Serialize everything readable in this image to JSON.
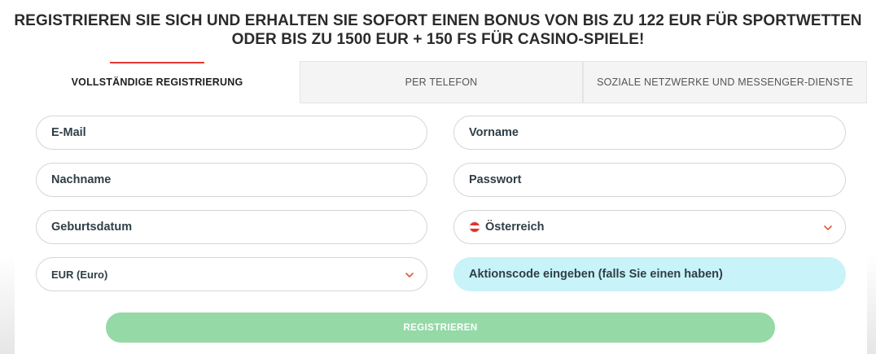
{
  "headline": "REGISTRIEREN SIE SICH UND ERHALTEN SIE SOFORT EINEN BONUS VON BIS ZU 122 EUR FÜR SPORTWETTEN ODER BIS ZU 1500 EUR + 150 FS FÜR CASINO-SPIELE!",
  "tabs": [
    {
      "label": "VOLLSTÄNDIGE REGISTRIERUNG",
      "active": true
    },
    {
      "label": "PER TELEFON",
      "active": false
    },
    {
      "label": "SOZIALE NETZWERKE UND MESSENGER-DIENSTE",
      "active": false
    }
  ],
  "form": {
    "email_placeholder": "E-Mail",
    "firstname_placeholder": "Vorname",
    "lastname_placeholder": "Nachname",
    "password_placeholder": "Passwort",
    "birthdate_placeholder": "Geburtsdatum",
    "country_value": "Österreich",
    "currency_value": "EUR (Euro)",
    "promo_placeholder": "Aktionscode eingeben (falls Sie einen haben)"
  },
  "submit_label": "REGISTRIEREN",
  "colors": {
    "accent_red": "#e53935",
    "button_green": "#94d9a6",
    "promo_bg": "#c8f3f8",
    "flag_red": "#e4312b",
    "flag_white": "#ffffff"
  },
  "icons": {
    "chevron": "chevron-down-icon",
    "flag": "austria-flag-icon"
  }
}
